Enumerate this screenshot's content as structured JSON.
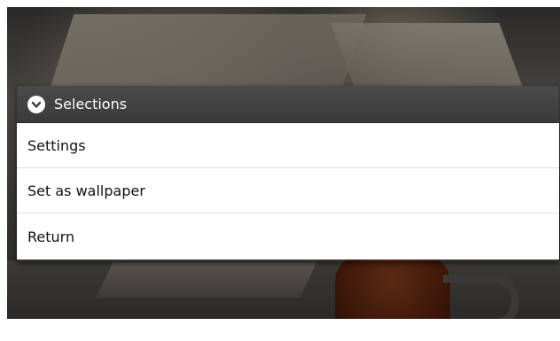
{
  "dialog": {
    "title": "Selections",
    "icon": "chevron-down-circle-icon"
  },
  "menu": {
    "items": [
      {
        "label": "Settings"
      },
      {
        "label": "Set as wallpaper"
      },
      {
        "label": "Return"
      }
    ]
  },
  "colors": {
    "header_bg": "#3f3f3f",
    "header_text": "#ffffff",
    "menu_bg": "#ffffff",
    "menu_text": "#111111",
    "divider": "#dcdcdc"
  }
}
